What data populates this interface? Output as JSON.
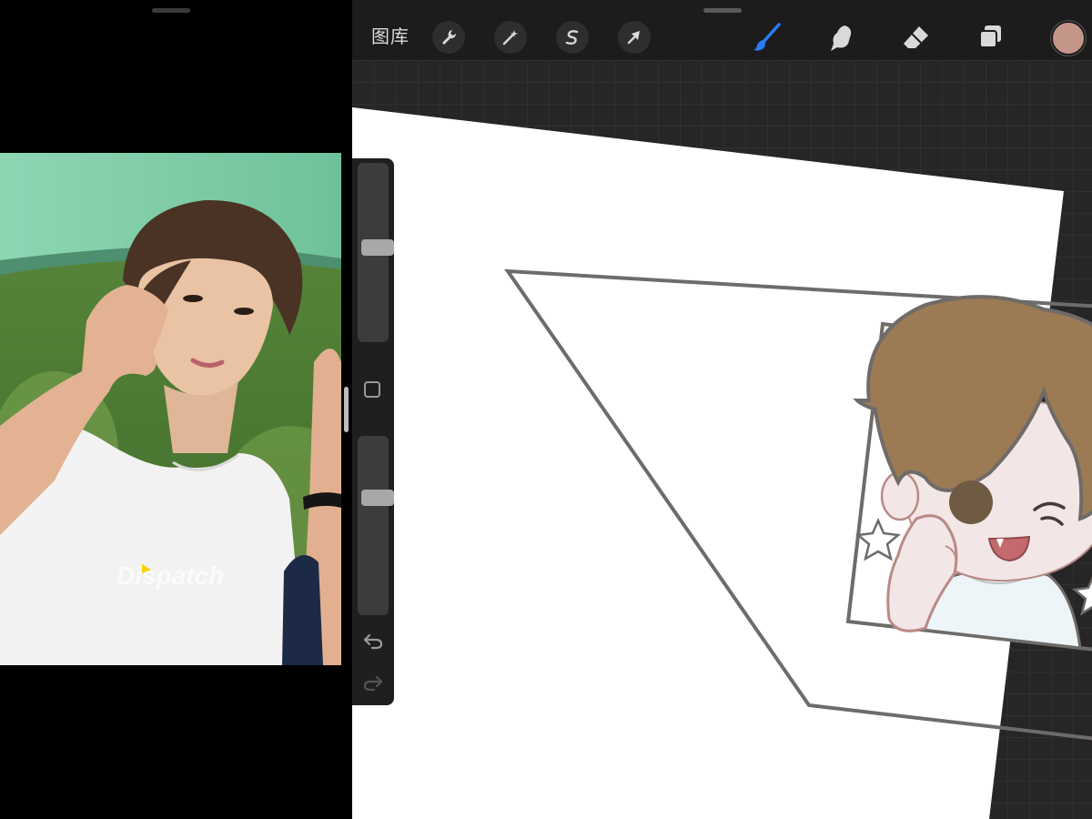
{
  "toolbar": {
    "gallery_label": "图库",
    "icons": [
      "wrench-icon",
      "magic-wand-icon",
      "selection-s-icon",
      "transform-arrow-icon",
      "brush-icon",
      "smudge-icon",
      "eraser-icon",
      "layers-icon"
    ],
    "active_tool": "brush",
    "active_color": "#c4968a",
    "brush_color": "#2a7cf6"
  },
  "side_bar": {
    "brush_size_level": 0.53,
    "opacity_level": 0.67,
    "icons": [
      "modify-square-icon",
      "undo-icon",
      "redo-icon"
    ]
  },
  "reference_photo": {
    "watermark": "Dispatch"
  },
  "artwork": {
    "hair_color": "#9b7a54",
    "skin_color": "#f3e6e6",
    "line_color": "#6f6b69"
  }
}
